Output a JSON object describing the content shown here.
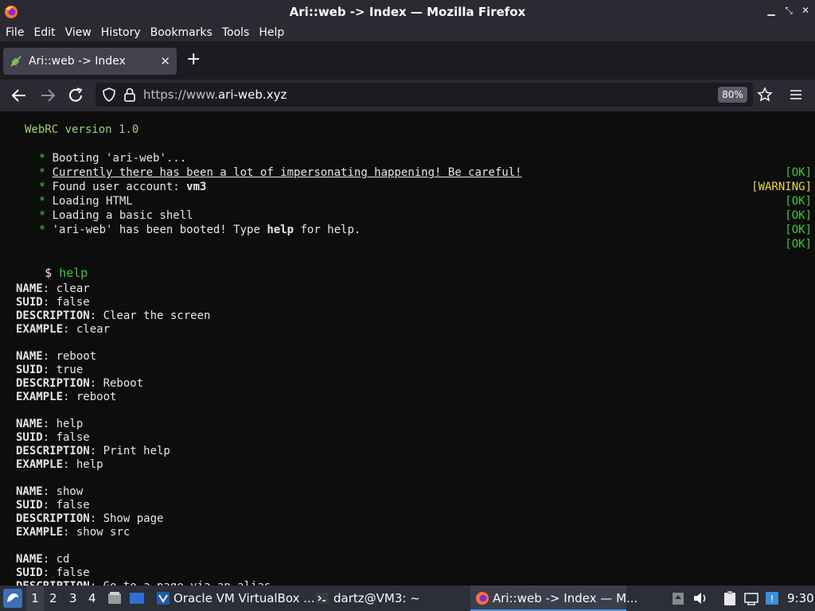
{
  "window": {
    "title": "Ari::web -> Index — Mozilla Firefox"
  },
  "menu": {
    "file": "File",
    "edit": "Edit",
    "view": "View",
    "history": "History",
    "bookmarks": "Bookmarks",
    "tools": "Tools",
    "help": "Help"
  },
  "tab": {
    "title": "Ari::web -> Index"
  },
  "url": {
    "prefix": "https://www.",
    "domain": "ari-web.xyz",
    "zoom": "80%"
  },
  "terminal": {
    "version": "WebRC version 1.0",
    "boot": [
      {
        "bullet": "*",
        "text": "Booting 'ari-web'...",
        "status": "[OK]",
        "kind": "ok"
      },
      {
        "bullet": "*",
        "text": "Currently there has been a lot of impersonating happening! Be careful!",
        "status": "[WARNING]",
        "kind": "warn"
      },
      {
        "bullet": "*",
        "text_pre": "Found user account: ",
        "text_bold": "vm3",
        "status": "[OK]",
        "kind": "ok"
      },
      {
        "bullet": "*",
        "text": "Loading HTML",
        "status": "[OK]",
        "kind": "ok"
      },
      {
        "bullet": "*",
        "text": "Loading a basic shell",
        "status": "[OK]",
        "kind": "ok"
      },
      {
        "bullet": "*",
        "text_pre": "'ari-web' has been booted! Type ",
        "text_bold": "help",
        "text_post": " for help.",
        "status": "[OK]",
        "kind": "ok"
      }
    ],
    "prompt": "$",
    "command": "help",
    "entries": [
      {
        "name": "clear",
        "suid": "false",
        "description": "Clear the screen",
        "example": "clear"
      },
      {
        "name": "reboot",
        "suid": "true",
        "description": "Reboot",
        "example": "reboot"
      },
      {
        "name": "help",
        "suid": "false",
        "description": "Print help",
        "example": "help"
      },
      {
        "name": "show",
        "suid": "false",
        "description": "Show page",
        "example": "show src"
      },
      {
        "name": "cd",
        "suid": "false",
        "description": "Go to a page via an alias",
        "example": ""
      }
    ],
    "labels": {
      "name": "NAME",
      "suid": "SUID",
      "description": "DESCRIPTION",
      "example": "EXAMPLE"
    }
  },
  "taskbar": {
    "workspaces": [
      "1",
      "2",
      "3",
      "4"
    ],
    "virtualbox": "Oracle VM VirtualBox ...",
    "terminal": "dartz@VM3: ~",
    "firefox": "Ari::web -> Index — M...",
    "clock": "9:30"
  },
  "colors": {
    "ok": "#3cc93c",
    "warning": "#e6d94a",
    "bg": "#0d0d0d",
    "chrome": "#2b2a33"
  }
}
